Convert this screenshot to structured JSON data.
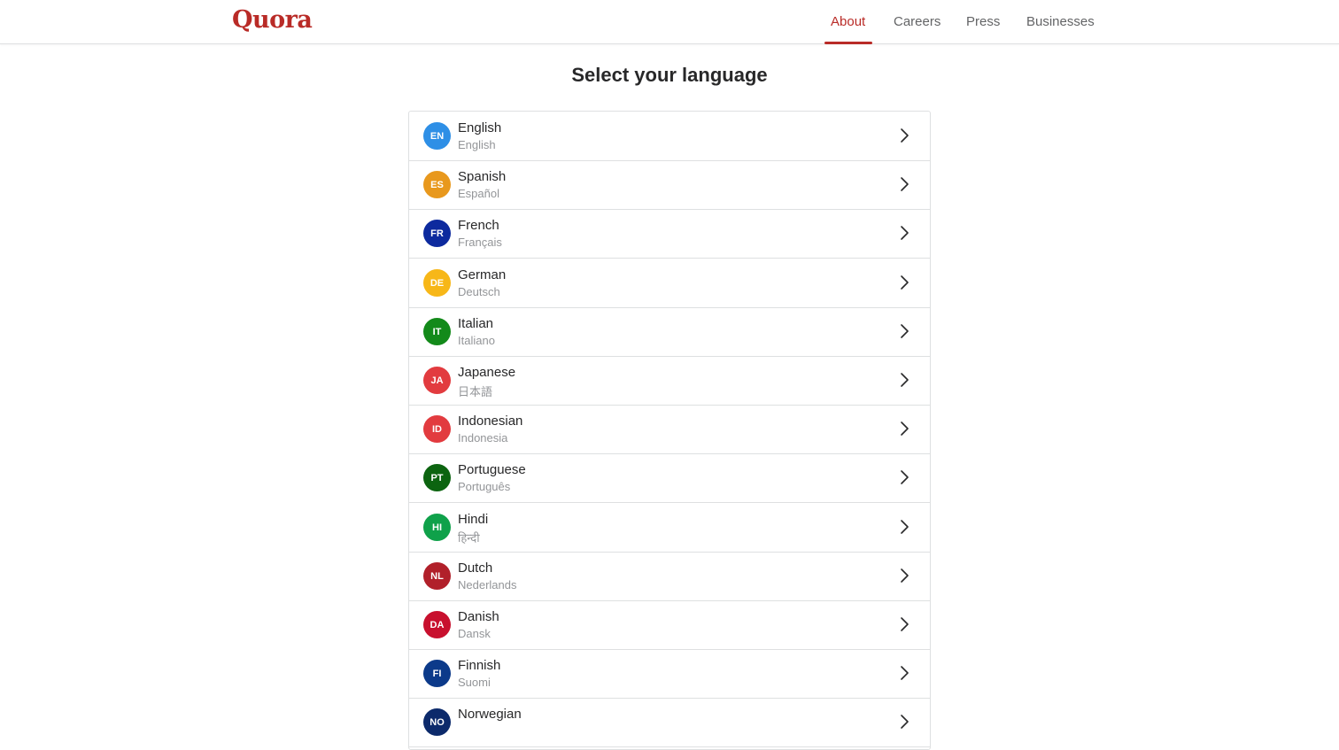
{
  "header": {
    "logo_text": "Quora",
    "nav": [
      {
        "label": "About",
        "active": true
      },
      {
        "label": "Careers",
        "active": false
      },
      {
        "label": "Press",
        "active": false
      },
      {
        "label": "Businesses",
        "active": false
      }
    ]
  },
  "main": {
    "title": "Select your language",
    "languages": [
      {
        "code": "EN",
        "name": "English",
        "native": "English",
        "color": "#2e8fe6"
      },
      {
        "code": "ES",
        "name": "Spanish",
        "native": "Español",
        "color": "#e8981d"
      },
      {
        "code": "FR",
        "name": "French",
        "native": "Français",
        "color": "#0d2a9e"
      },
      {
        "code": "DE",
        "name": "German",
        "native": "Deutsch",
        "color": "#f7b718"
      },
      {
        "code": "IT",
        "name": "Italian",
        "native": "Italiano",
        "color": "#138a1a"
      },
      {
        "code": "JA",
        "name": "Japanese",
        "native": "日本語",
        "color": "#e23b3f"
      },
      {
        "code": "ID",
        "name": "Indonesian",
        "native": "Indonesia",
        "color": "#e23b3f"
      },
      {
        "code": "PT",
        "name": "Portuguese",
        "native": "Português",
        "color": "#0c6410"
      },
      {
        "code": "HI",
        "name": "Hindi",
        "native": "हिन्दी",
        "color": "#0fa14a"
      },
      {
        "code": "NL",
        "name": "Dutch",
        "native": "Nederlands",
        "color": "#b1202a"
      },
      {
        "code": "DA",
        "name": "Danish",
        "native": "Dansk",
        "color": "#c8102e"
      },
      {
        "code": "FI",
        "name": "Finnish",
        "native": "Suomi",
        "color": "#0c3a8a"
      },
      {
        "code": "NO",
        "name": "Norwegian",
        "native": "",
        "color": "#0c2a6b"
      }
    ]
  }
}
